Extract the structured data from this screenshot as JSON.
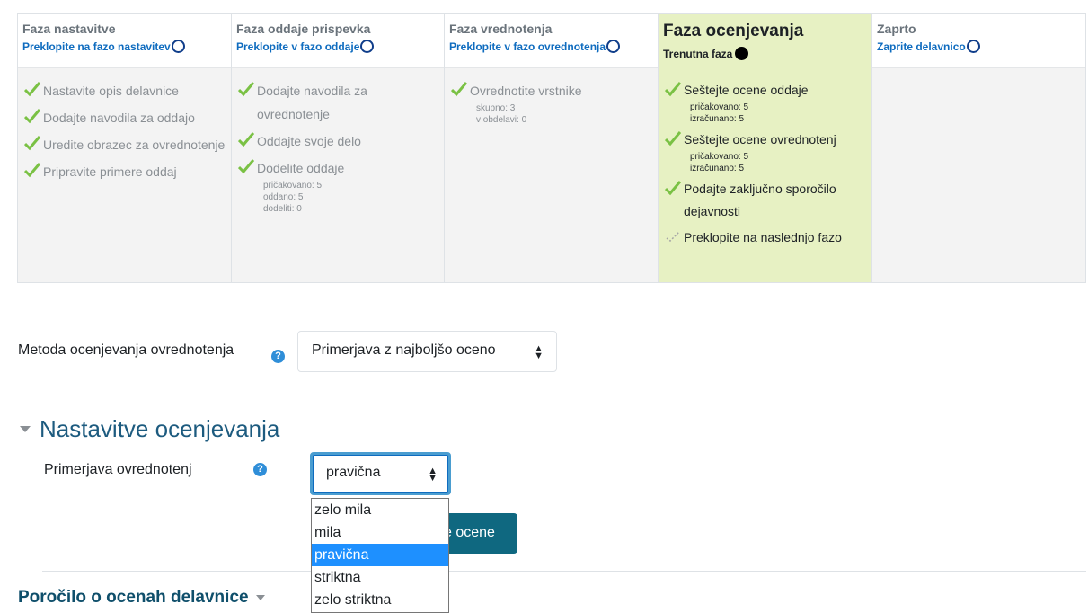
{
  "phases": [
    {
      "title": "Faza nastavitve",
      "link": "Preklopite na fazo nastavitev",
      "tasks": [
        {
          "text": "Nastavite opis delavnice",
          "icon": "check-icon"
        },
        {
          "text": "Dodajte navodila za oddajo",
          "icon": "check-icon"
        },
        {
          "text": "Uredite obrazec za ovrednotenje",
          "icon": "check-icon"
        },
        {
          "text": "Pripravite primere oddaj",
          "icon": "check-icon"
        }
      ]
    },
    {
      "title": "Faza oddaje prispevka",
      "link": "Preklopite v fazo oddaje",
      "tasks": [
        {
          "text": "Dodajte navodila za ovrednotenje",
          "icon": "check-icon"
        },
        {
          "text": "Oddajte svoje delo",
          "icon": "check-icon"
        },
        {
          "text": "Dodelite oddaje",
          "icon": "check-icon",
          "meta": [
            "pričakovano: 5",
            "oddano: 5",
            "dodeliti: 0"
          ]
        }
      ]
    },
    {
      "title": "Faza vrednotenja",
      "link": "Preklopite v fazo ovrednotenja",
      "tasks": [
        {
          "text": "Ovrednotite vrstnike",
          "icon": "check-icon",
          "meta": [
            "skupno: 3",
            "v obdelavi: 0"
          ]
        }
      ]
    },
    {
      "title": "Faza ocenjevanja",
      "link": "Trenutna faza",
      "tasks": [
        {
          "text": "Seštejte ocene oddaje",
          "icon": "check-icon",
          "meta": [
            "pričakovano: 5",
            "izračunano: 5"
          ]
        },
        {
          "text": "Seštejte ocene ovrednotenj",
          "icon": "check-icon",
          "meta": [
            "pričakovano: 5",
            "izračunano: 5"
          ]
        },
        {
          "text": "Podajte zaključno sporočilo dejavnosti",
          "icon": "check-icon"
        },
        {
          "text": "Preklopite na naslednjo fazo",
          "icon": "pending-check-icon"
        }
      ]
    },
    {
      "title": "Zaprto",
      "link": "Zaprite delavnico",
      "tasks": []
    }
  ],
  "grading_method": {
    "label": "Metoda ocenjevanja ovrednotenja",
    "value": "Primerjava z najboljšo oceno"
  },
  "grading_settings": {
    "title": "Nastavitve ocenjevanja",
    "comparison_label": "Primerjava ovrednotenj",
    "comparison_value": "pravična",
    "options": [
      "zelo mila",
      "mila",
      "pravična",
      "striktna",
      "zelo striktna"
    ],
    "selected_index": 2,
    "button_label_visible": "e ocene"
  },
  "report": {
    "title": "Poročilo o ocenah delavnice"
  },
  "colors": {
    "accent_link": "#0f6cbf",
    "active_phase_bg": "#e7f1c3",
    "check_green": "#7ac144",
    "button_bg": "#0f6880",
    "dropdown_selected": "#1e90ff"
  }
}
